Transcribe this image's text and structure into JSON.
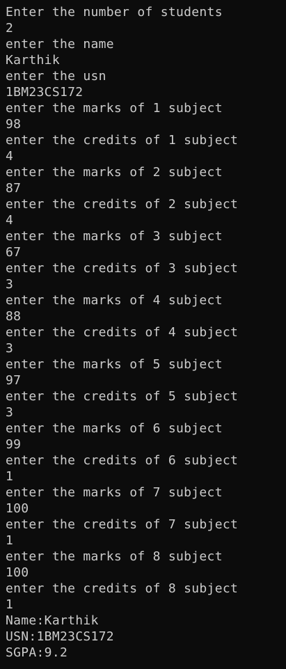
{
  "terminal": {
    "lines": [
      "Enter the number of students",
      "2",
      "enter the name",
      "Karthik",
      "enter the usn",
      "1BM23CS172",
      "enter the marks of 1 subject",
      "98",
      "enter the credits of 1 subject",
      "4",
      "enter the marks of 2 subject",
      "87",
      "enter the credits of 2 subject",
      "4",
      "enter the marks of 3 subject",
      "67",
      "enter the credits of 3 subject",
      "3",
      "enter the marks of 4 subject",
      "88",
      "enter the credits of 4 subject",
      "3",
      "enter the marks of 5 subject",
      "97",
      "enter the credits of 5 subject",
      "3",
      "enter the marks of 6 subject",
      "99",
      "enter the credits of 6 subject",
      "1",
      "enter the marks of 7 subject",
      "100",
      "enter the credits of 7 subject",
      "1",
      "enter the marks of 8 subject",
      "100",
      "enter the credits of 8 subject",
      "1",
      "Name:Karthik",
      "USN:1BM23CS172",
      "SGPA:9.2"
    ]
  }
}
